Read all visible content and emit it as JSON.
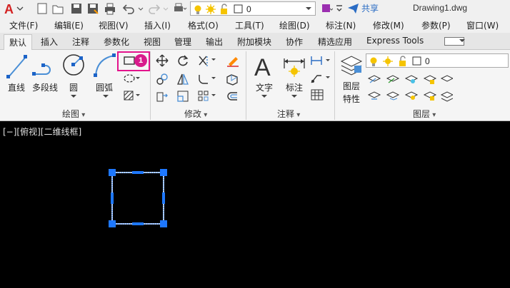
{
  "qat": {
    "layer_value": "0",
    "share_label": "共享",
    "doc_title": "Drawing1.dwg"
  },
  "menu": [
    "文件(F)",
    "编辑(E)",
    "视图(V)",
    "插入(I)",
    "格式(O)",
    "工具(T)",
    "绘图(D)",
    "标注(N)",
    "修改(M)",
    "参数(P)",
    "窗口(W)"
  ],
  "tabs": [
    "默认",
    "插入",
    "注释",
    "参数化",
    "视图",
    "管理",
    "输出",
    "附加模块",
    "协作",
    "精选应用",
    "Express Tools"
  ],
  "ribbon": {
    "draw": {
      "line": "直线",
      "polyline": "多段线",
      "circle": "圆",
      "arc": "圆弧",
      "panel": "绘图"
    },
    "modify": {
      "panel": "修改"
    },
    "annotate": {
      "text": "文字",
      "dimension": "标注",
      "panel": "注释"
    },
    "layers": {
      "properties_1": "图层",
      "properties_2": "特性",
      "layer_value": "0",
      "panel": "图层"
    }
  },
  "callout": {
    "number": "1"
  },
  "canvas": {
    "viewport_label": "[−][俯视][二维线框]"
  },
  "colors": {
    "accent": "#e3138c",
    "selection": "#1e78ff",
    "share": "#2a6cc4"
  }
}
